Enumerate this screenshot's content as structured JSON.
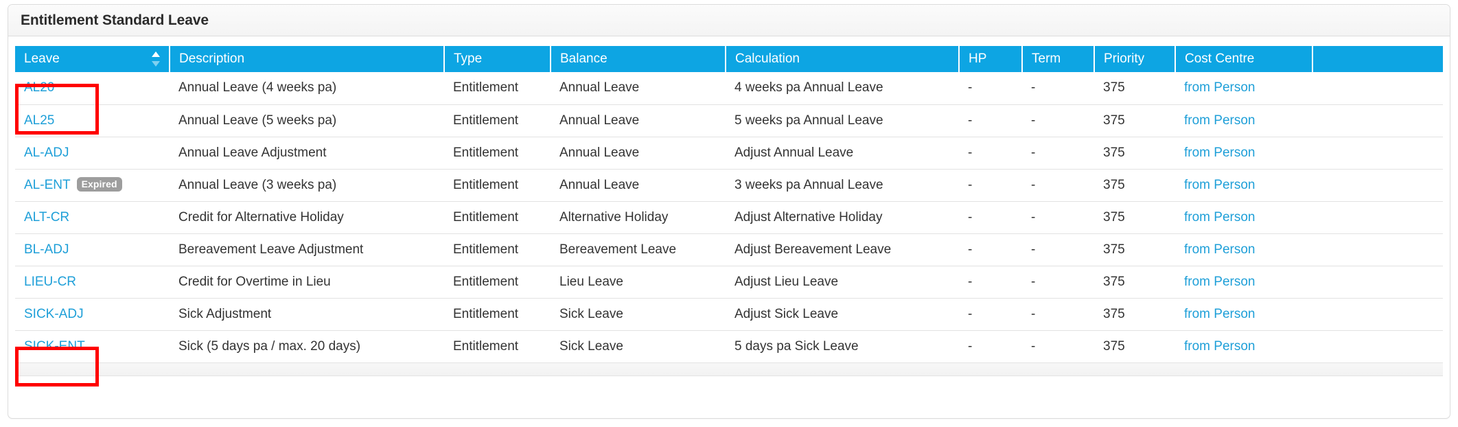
{
  "panel": {
    "title": "Entitlement Standard Leave"
  },
  "table": {
    "columns": [
      {
        "key": "leave",
        "label": "Leave",
        "sortable": true,
        "sort_icon": "sort-both-icon"
      },
      {
        "key": "description",
        "label": "Description",
        "sortable": false
      },
      {
        "key": "type",
        "label": "Type",
        "sortable": false
      },
      {
        "key": "balance",
        "label": "Balance",
        "sortable": false
      },
      {
        "key": "calculation",
        "label": "Calculation",
        "sortable": false
      },
      {
        "key": "hp",
        "label": "HP",
        "sortable": false
      },
      {
        "key": "term",
        "label": "Term",
        "sortable": false
      },
      {
        "key": "priority",
        "label": "Priority",
        "sortable": false
      },
      {
        "key": "cost_centre",
        "label": "Cost Centre",
        "sortable": false
      },
      {
        "key": "actions",
        "label": "",
        "sortable": false
      }
    ],
    "rows": [
      {
        "leave": "AL20",
        "badge": "",
        "description": "Annual Leave (4 weeks pa)",
        "type": "Entitlement",
        "balance": "Annual Leave",
        "calculation": "4 weeks pa Annual Leave",
        "hp": "-",
        "term": "-",
        "priority": "375",
        "cost_centre": "from Person"
      },
      {
        "leave": "AL25",
        "badge": "",
        "description": "Annual Leave (5 weeks pa)",
        "type": "Entitlement",
        "balance": "Annual Leave",
        "calculation": "5 weeks pa Annual Leave",
        "hp": "-",
        "term": "-",
        "priority": "375",
        "cost_centre": "from Person"
      },
      {
        "leave": "AL-ADJ",
        "badge": "",
        "description": "Annual Leave Adjustment",
        "type": "Entitlement",
        "balance": "Annual Leave",
        "calculation": "Adjust Annual Leave",
        "hp": "-",
        "term": "-",
        "priority": "375",
        "cost_centre": "from Person"
      },
      {
        "leave": "AL-ENT",
        "badge": "Expired",
        "description": "Annual Leave (3 weeks pa)",
        "type": "Entitlement",
        "balance": "Annual Leave",
        "calculation": "3 weeks pa Annual Leave",
        "hp": "-",
        "term": "-",
        "priority": "375",
        "cost_centre": "from Person"
      },
      {
        "leave": "ALT-CR",
        "badge": "",
        "description": "Credit for Alternative Holiday",
        "type": "Entitlement",
        "balance": "Alternative Holiday",
        "calculation": "Adjust Alternative Holiday",
        "hp": "-",
        "term": "-",
        "priority": "375",
        "cost_centre": "from Person"
      },
      {
        "leave": "BL-ADJ",
        "badge": "",
        "description": "Bereavement Leave Adjustment",
        "type": "Entitlement",
        "balance": "Bereavement Leave",
        "calculation": "Adjust Bereavement Leave",
        "hp": "-",
        "term": "-",
        "priority": "375",
        "cost_centre": "from Person"
      },
      {
        "leave": "LIEU-CR",
        "badge": "",
        "description": "Credit for Overtime in Lieu",
        "type": "Entitlement",
        "balance": "Lieu Leave",
        "calculation": "Adjust Lieu Leave",
        "hp": "-",
        "term": "-",
        "priority": "375",
        "cost_centre": "from Person"
      },
      {
        "leave": "SICK-ADJ",
        "badge": "",
        "description": "Sick Adjustment",
        "type": "Entitlement",
        "balance": "Sick Leave",
        "calculation": "Adjust Sick Leave",
        "hp": "-",
        "term": "-",
        "priority": "375",
        "cost_centre": "from Person"
      },
      {
        "leave": "SICK-ENT",
        "badge": "",
        "description": "Sick (5 days pa / max. 20 days)",
        "type": "Entitlement",
        "balance": "Sick Leave",
        "calculation": "5 days pa Sick Leave",
        "hp": "-",
        "term": "-",
        "priority": "375",
        "cost_centre": "from Person"
      }
    ]
  },
  "annotations": [
    {
      "id": "annot-a",
      "target": "leave-rows-al20-al25",
      "color": "#ff0000"
    },
    {
      "id": "annot-b",
      "target": "leave-row-sick-ent",
      "color": "#ff0000"
    }
  ],
  "colors": {
    "header_blue": "#0da5e3",
    "link_blue": "#1e9fd8",
    "badge_gray": "#9d9d9d",
    "annotation_red": "#ff0000",
    "row_border": "#e2e2e2"
  }
}
